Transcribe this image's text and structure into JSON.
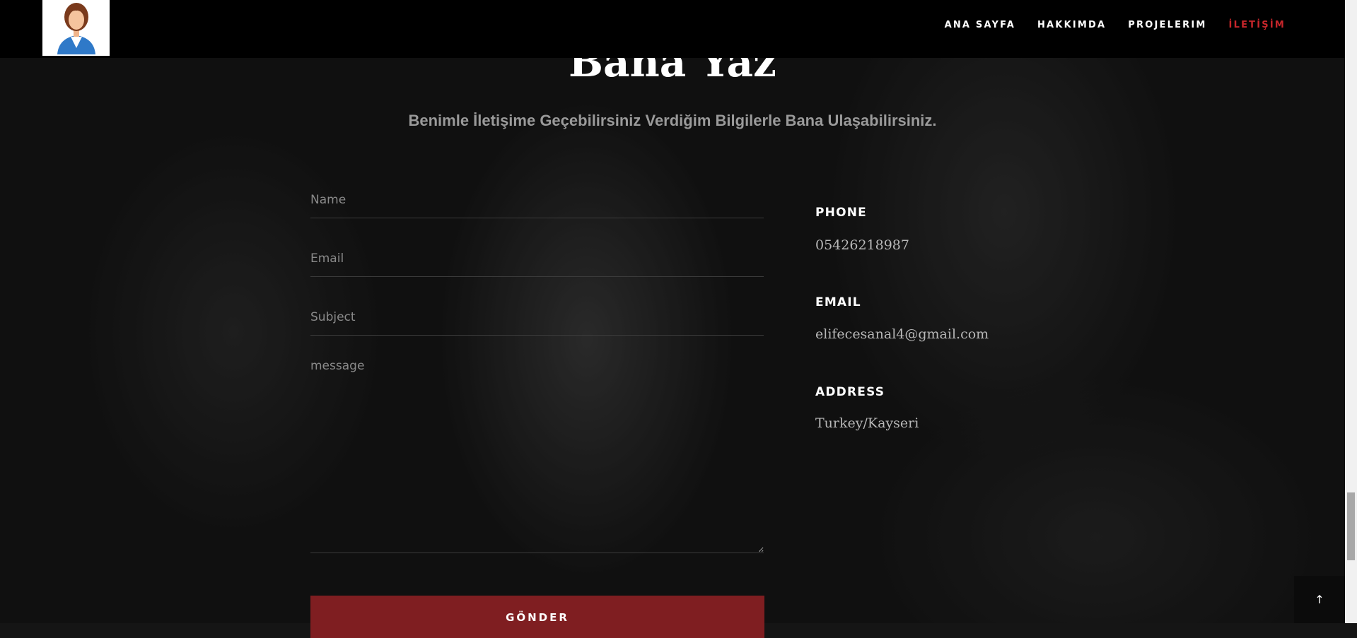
{
  "nav": {
    "items": [
      "ANA SAYFA",
      "HAKKIMDA",
      "PROJELERIM",
      "İLETİŞİM"
    ],
    "active_index": 3,
    "active_color": "#c8262b"
  },
  "logo": {
    "icon": "user-avatar-icon"
  },
  "contact": {
    "title": "Bana Yaz",
    "subtitle": "Benimle İletişime Geçebilirsiniz Verdiğim Bilgilerle Bana Ulaşabilirsiniz."
  },
  "form": {
    "name_placeholder": "Name",
    "email_placeholder": "Email",
    "subject_placeholder": "Subject",
    "message_placeholder": "message",
    "submit_label": "GÖNDER",
    "submit_color": "#7f1e21"
  },
  "info": {
    "phone_label": "PHONE",
    "phone_value": "05426218987",
    "email_label": "EMAIL",
    "email_value": "elifecesanal4@gmail.com",
    "address_label": "ADDRESS",
    "address_value": "Turkey/Kayseri"
  },
  "back_to_top": {
    "icon": "arrow-up-icon",
    "glyph": "↑"
  }
}
